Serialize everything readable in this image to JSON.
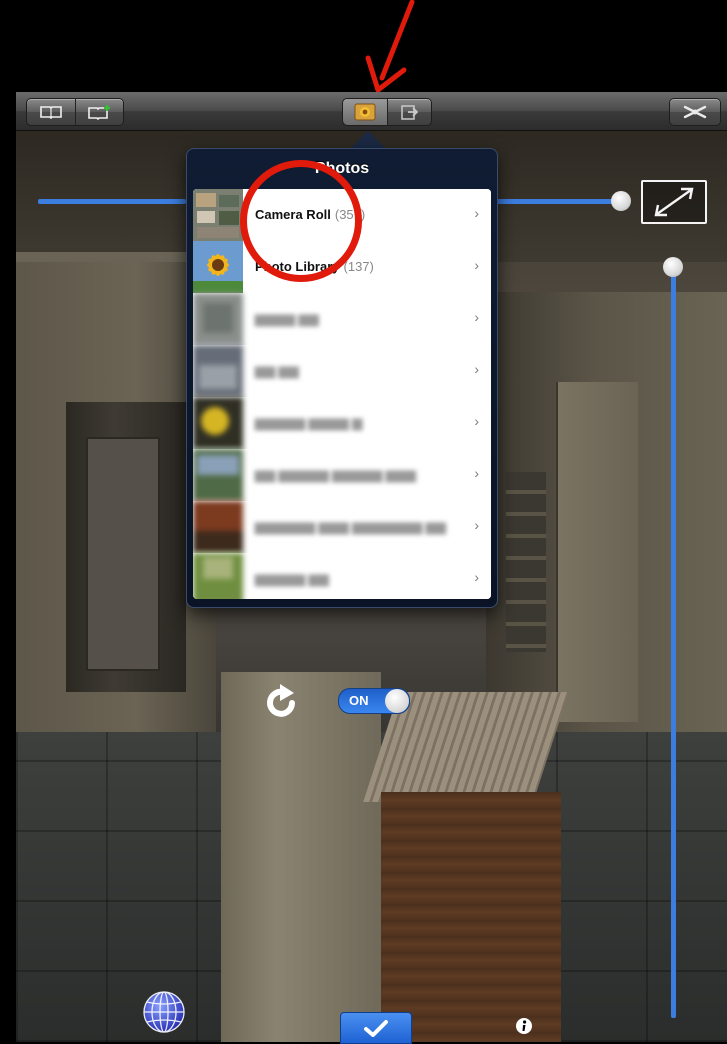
{
  "annotation": {
    "arrow_color": "#e11b0c",
    "circle_color": "#e11b0c"
  },
  "toolbar": {
    "left_segment": [
      "bookmarks-icon",
      "add-bookmark-icon"
    ],
    "middle_segment": [
      "photos-icon",
      "share-icon"
    ],
    "right_button": "tools-icon"
  },
  "popover": {
    "title": "Photos",
    "rows": [
      {
        "label": "Camera Roll",
        "count": "(357)",
        "thumb": "camera-roll-thumb",
        "blurred": false
      },
      {
        "label": "Photo Library",
        "count": "(137)",
        "thumb": "sunflower-thumb",
        "blurred": false
      },
      {
        "label": "",
        "count": "",
        "thumb": "album-thumb",
        "blurred": true
      },
      {
        "label": "",
        "count": "",
        "thumb": "album-thumb",
        "blurred": true
      },
      {
        "label": "",
        "count": "",
        "thumb": "album-thumb",
        "blurred": true
      },
      {
        "label": "",
        "count": "",
        "thumb": "album-thumb",
        "blurred": true
      },
      {
        "label": "",
        "count": "",
        "thumb": "album-thumb",
        "blurred": true
      },
      {
        "label": "",
        "count": "",
        "thumb": "album-thumb",
        "blurred": true
      }
    ],
    "chevron": "›"
  },
  "controls": {
    "toggle_label": "ON",
    "toggle_state": true
  },
  "colors": {
    "accent": "#3c7ee0",
    "toolbar": "#4b4b4b",
    "popover": "#0f1c33"
  }
}
